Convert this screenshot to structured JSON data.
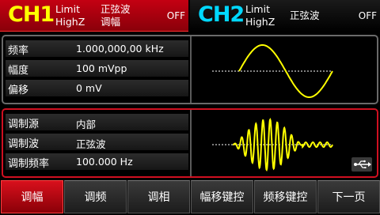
{
  "ch1": {
    "name": "CH1",
    "limit_label": "Limit",
    "impedance": "HighZ",
    "waveform": "正弦波",
    "modulation": "调幅",
    "output_state": "OFF",
    "accent_color": "#c40012",
    "name_color": "#ffff00"
  },
  "ch2": {
    "name": "CH2",
    "limit_label": "Limit",
    "impedance": "HighZ",
    "waveform": "正弦波",
    "output_state": "OFF",
    "name_color": "#00d8ff"
  },
  "params": [
    {
      "label": "频率",
      "value": "1.000,000,00 kHz"
    },
    {
      "label": "幅度",
      "value": "100 mVpp"
    },
    {
      "label": "偏移",
      "value": "0 mV"
    }
  ],
  "modulation": [
    {
      "label": "调制源",
      "value": "内部"
    },
    {
      "label": "调制波",
      "value": "正弦波"
    },
    {
      "label": "调制频率",
      "value": "100.000 Hz"
    }
  ],
  "softkeys": [
    "调幅",
    "调频",
    "调相",
    "幅移键控",
    "频移键控",
    "下一页"
  ],
  "active_softkey": "调幅",
  "icons": {
    "usb": "usb-icon"
  },
  "colors": {
    "waveform": "#ffff00",
    "mod_border": "#d01020",
    "panel_border": "#6a6a6a"
  }
}
